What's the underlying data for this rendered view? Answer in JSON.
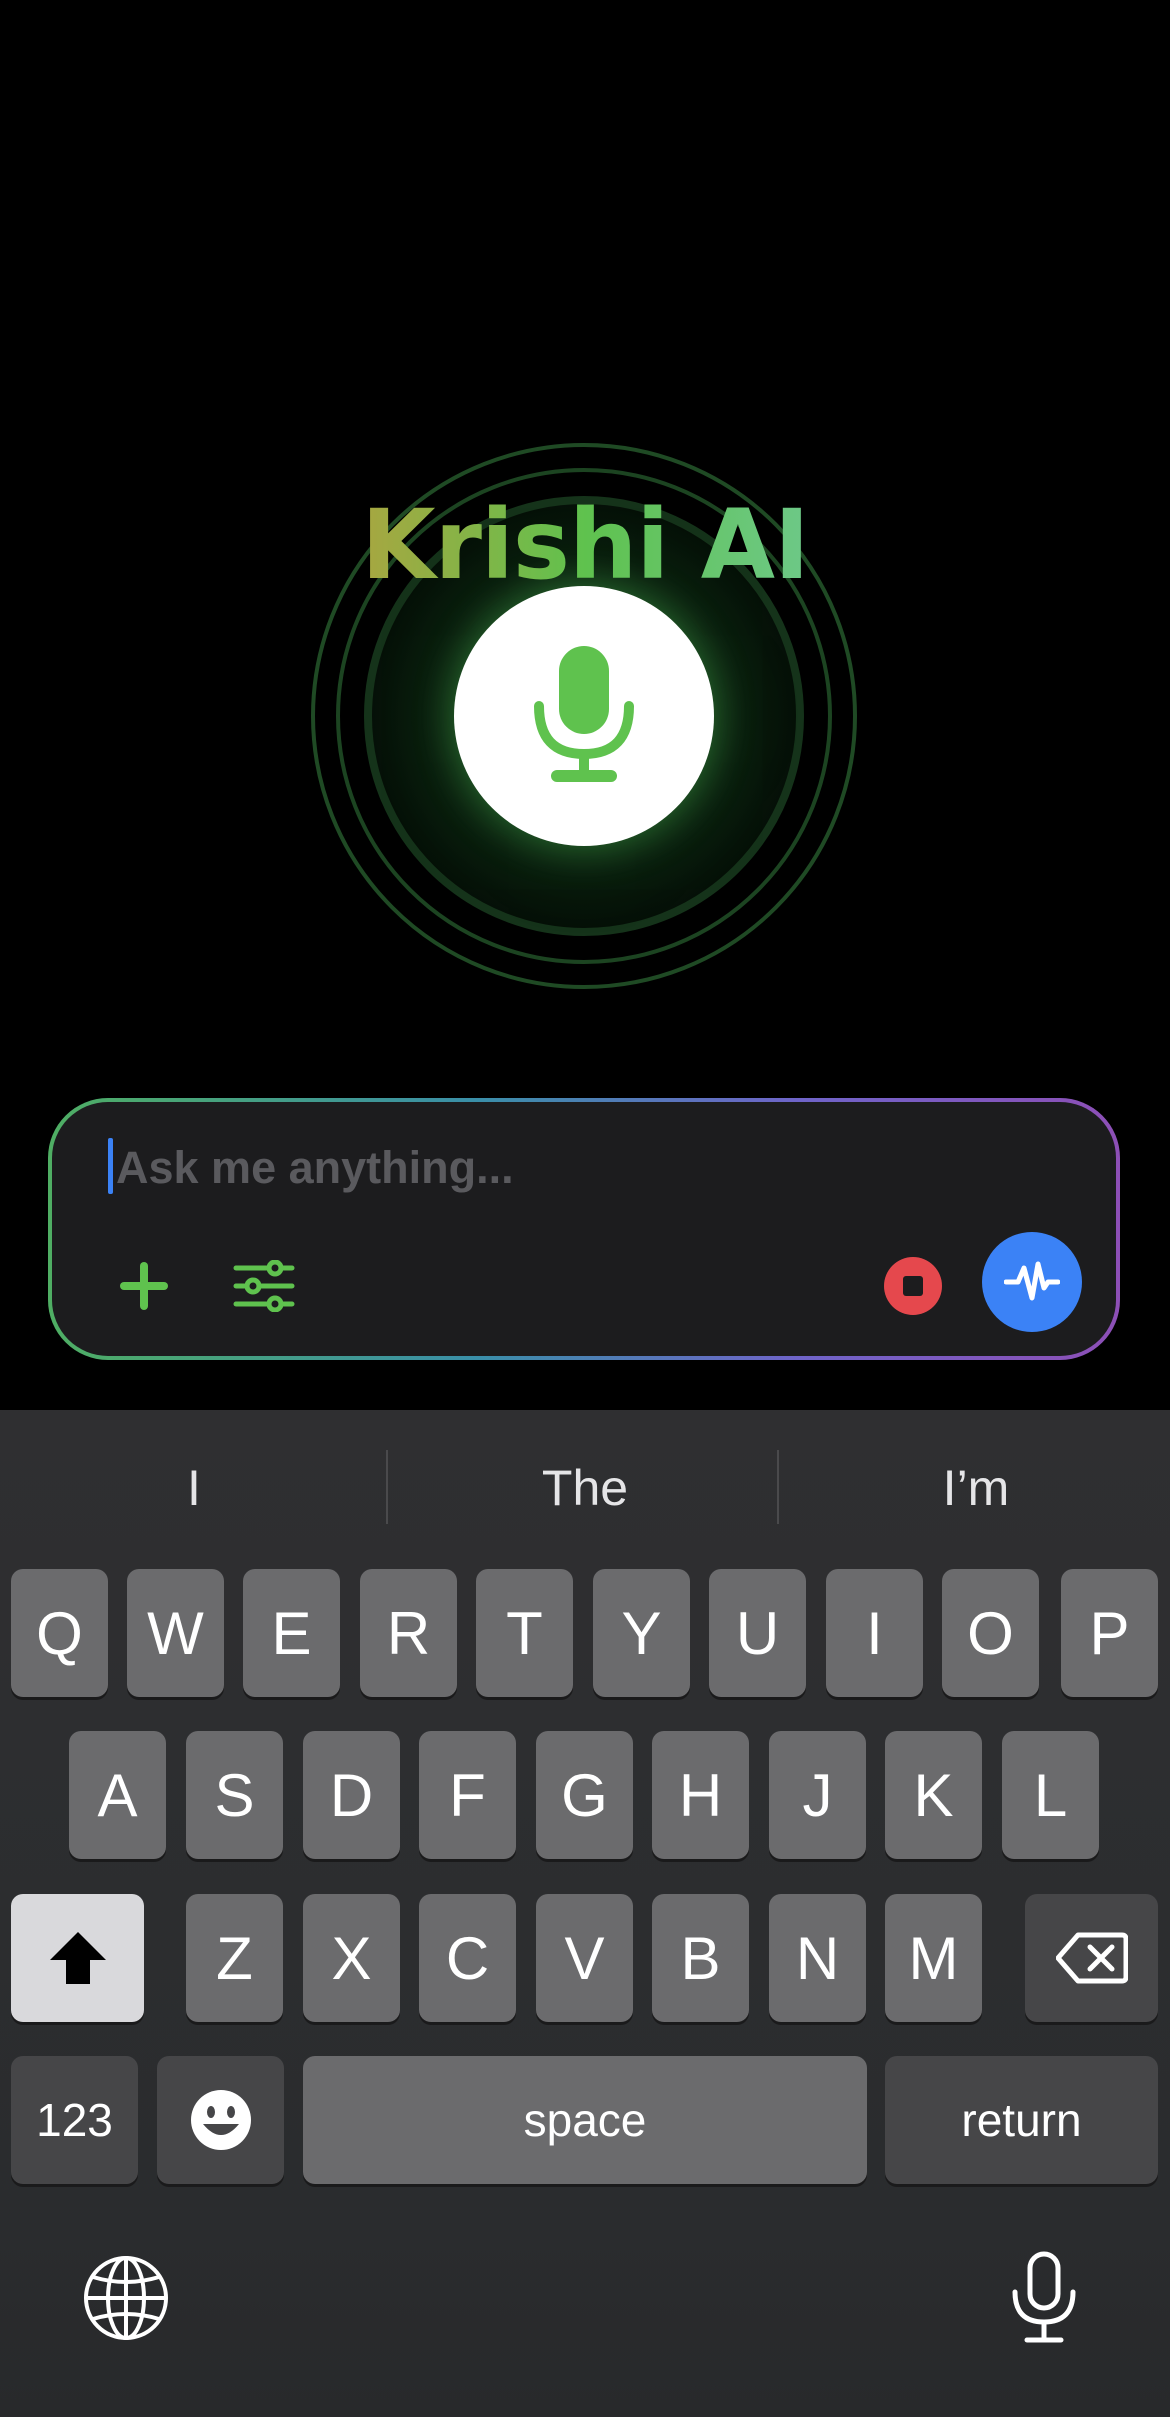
{
  "app": {
    "title": "Krishi AI",
    "title_gradient": [
      "#e5855a",
      "#5fc24e",
      "#d3a3aa"
    ],
    "accent_green": "#5fc24e",
    "accent_blue": "#3b82f6",
    "stop_red": "#e5484d"
  },
  "voice": {
    "mic_icon": "microphone-icon"
  },
  "input": {
    "placeholder": "Ask me anything...",
    "value": "",
    "tools": {
      "add_icon": "plus-icon",
      "settings_icon": "sliders-icon",
      "stop_icon": "stop-icon",
      "voice_mode_icon": "waveform-icon"
    }
  },
  "keyboard": {
    "suggestions": [
      "I",
      "The",
      "I’m"
    ],
    "row1": [
      "Q",
      "W",
      "E",
      "R",
      "T",
      "Y",
      "U",
      "I",
      "O",
      "P"
    ],
    "row2": [
      "A",
      "S",
      "D",
      "F",
      "G",
      "H",
      "J",
      "K",
      "L"
    ],
    "row3": [
      "Z",
      "X",
      "C",
      "V",
      "B",
      "N",
      "M"
    ],
    "numbers_label": "123",
    "space_label": "space",
    "return_label": "return",
    "shift_icon": "shift-icon",
    "delete_icon": "delete-icon",
    "emoji_icon": "emoji-icon",
    "globe_icon": "globe-icon",
    "dictation_icon": "microphone-icon"
  }
}
